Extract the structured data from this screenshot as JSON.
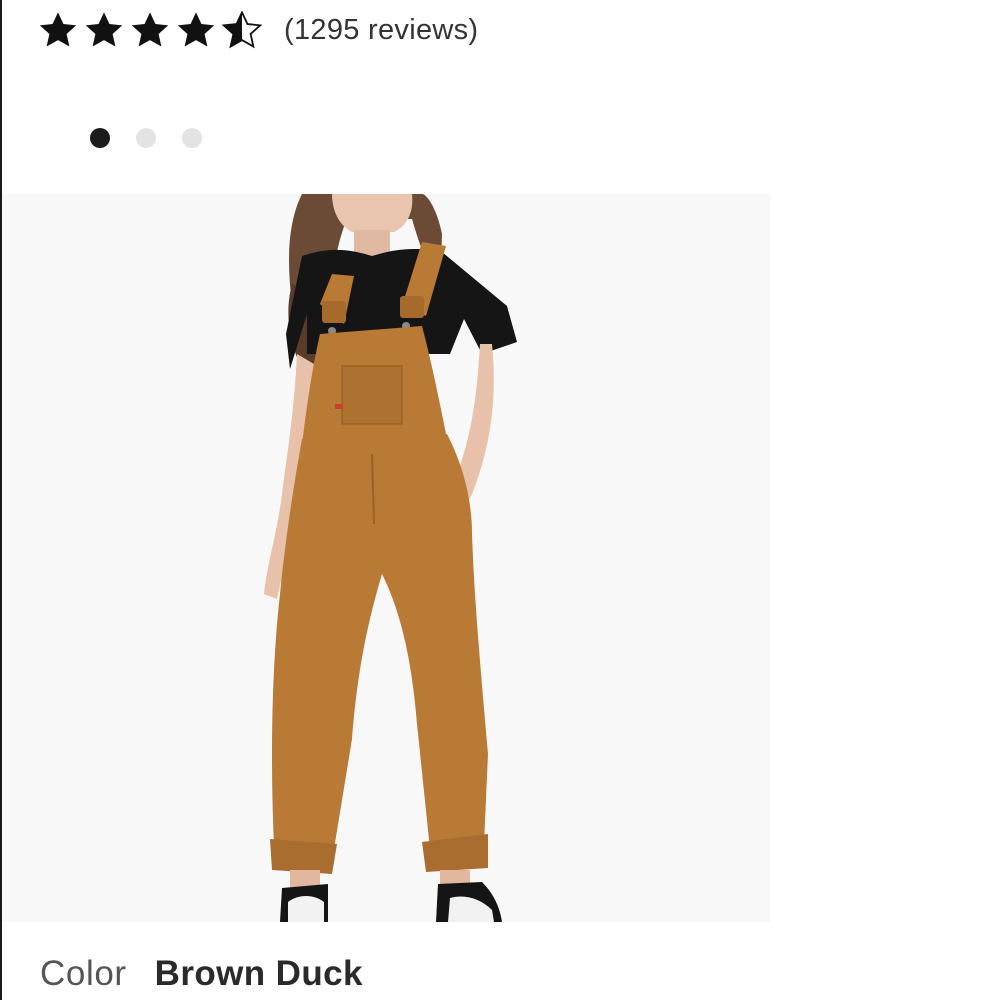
{
  "rating": {
    "stars": 4.5,
    "max_stars": 5,
    "review_count_text": "(1295 reviews)"
  },
  "carousel": {
    "total": 3,
    "active_index": 0
  },
  "product_image": {
    "icon": "product-photo-overalls"
  },
  "color": {
    "label": "Color",
    "value": "Brown Duck"
  },
  "colors": {
    "star": "#111111",
    "dot_active": "#1c1c1c",
    "dot_inactive": "#e3e3e3",
    "overalls": "#b87a35",
    "background_panel": "#f8f8f8"
  }
}
